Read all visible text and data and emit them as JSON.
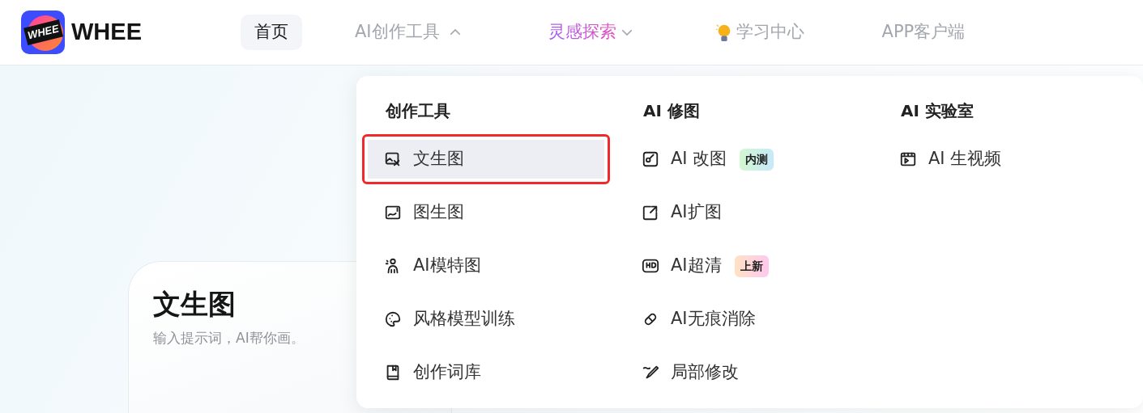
{
  "brand": {
    "name": "WHEE",
    "logo_text": "WHEE"
  },
  "nav": [
    {
      "label": "首页",
      "selected": true,
      "kind": "plain"
    },
    {
      "label": "AI创作工具",
      "selected": false,
      "kind": "menu",
      "expanded": true
    },
    {
      "label": "灵感探索",
      "selected": false,
      "kind": "gradient_menu",
      "expanded": false
    },
    {
      "label": "学习中心",
      "selected": false,
      "kind": "bulb"
    },
    {
      "label": "APP客户端",
      "selected": false,
      "kind": "plain"
    }
  ],
  "dropdown": {
    "columns": [
      {
        "title": "创作工具",
        "items": [
          {
            "label": "文生图",
            "selected": true,
            "highlighted": true
          },
          {
            "label": "图生图",
            "selected": false,
            "highlighted": false
          },
          {
            "label": "AI模特图",
            "selected": false,
            "highlighted": false
          },
          {
            "label": "风格模型训练",
            "selected": false,
            "highlighted": false
          },
          {
            "label": "创作词库",
            "selected": false,
            "highlighted": false
          }
        ]
      },
      {
        "title": "AI 修图",
        "items": [
          {
            "label": "AI 改图",
            "selected": false,
            "highlighted": false,
            "badge": {
              "text": "内测",
              "kind": "beta"
            }
          },
          {
            "label": "AI扩图",
            "selected": false,
            "highlighted": false
          },
          {
            "label": "AI超清",
            "selected": false,
            "highlighted": false,
            "badge": {
              "text": "上新",
              "kind": "new"
            }
          },
          {
            "label": "AI无痕消除",
            "selected": false,
            "highlighted": false
          },
          {
            "label": "局部修改",
            "selected": false,
            "highlighted": false
          }
        ]
      },
      {
        "title": "AI 实验室",
        "items": [
          {
            "label": "AI 生视频",
            "selected": false,
            "highlighted": false
          }
        ]
      }
    ]
  },
  "card": {
    "title": "文生图",
    "subtitle": "输入提示词，AI帮你画。"
  }
}
